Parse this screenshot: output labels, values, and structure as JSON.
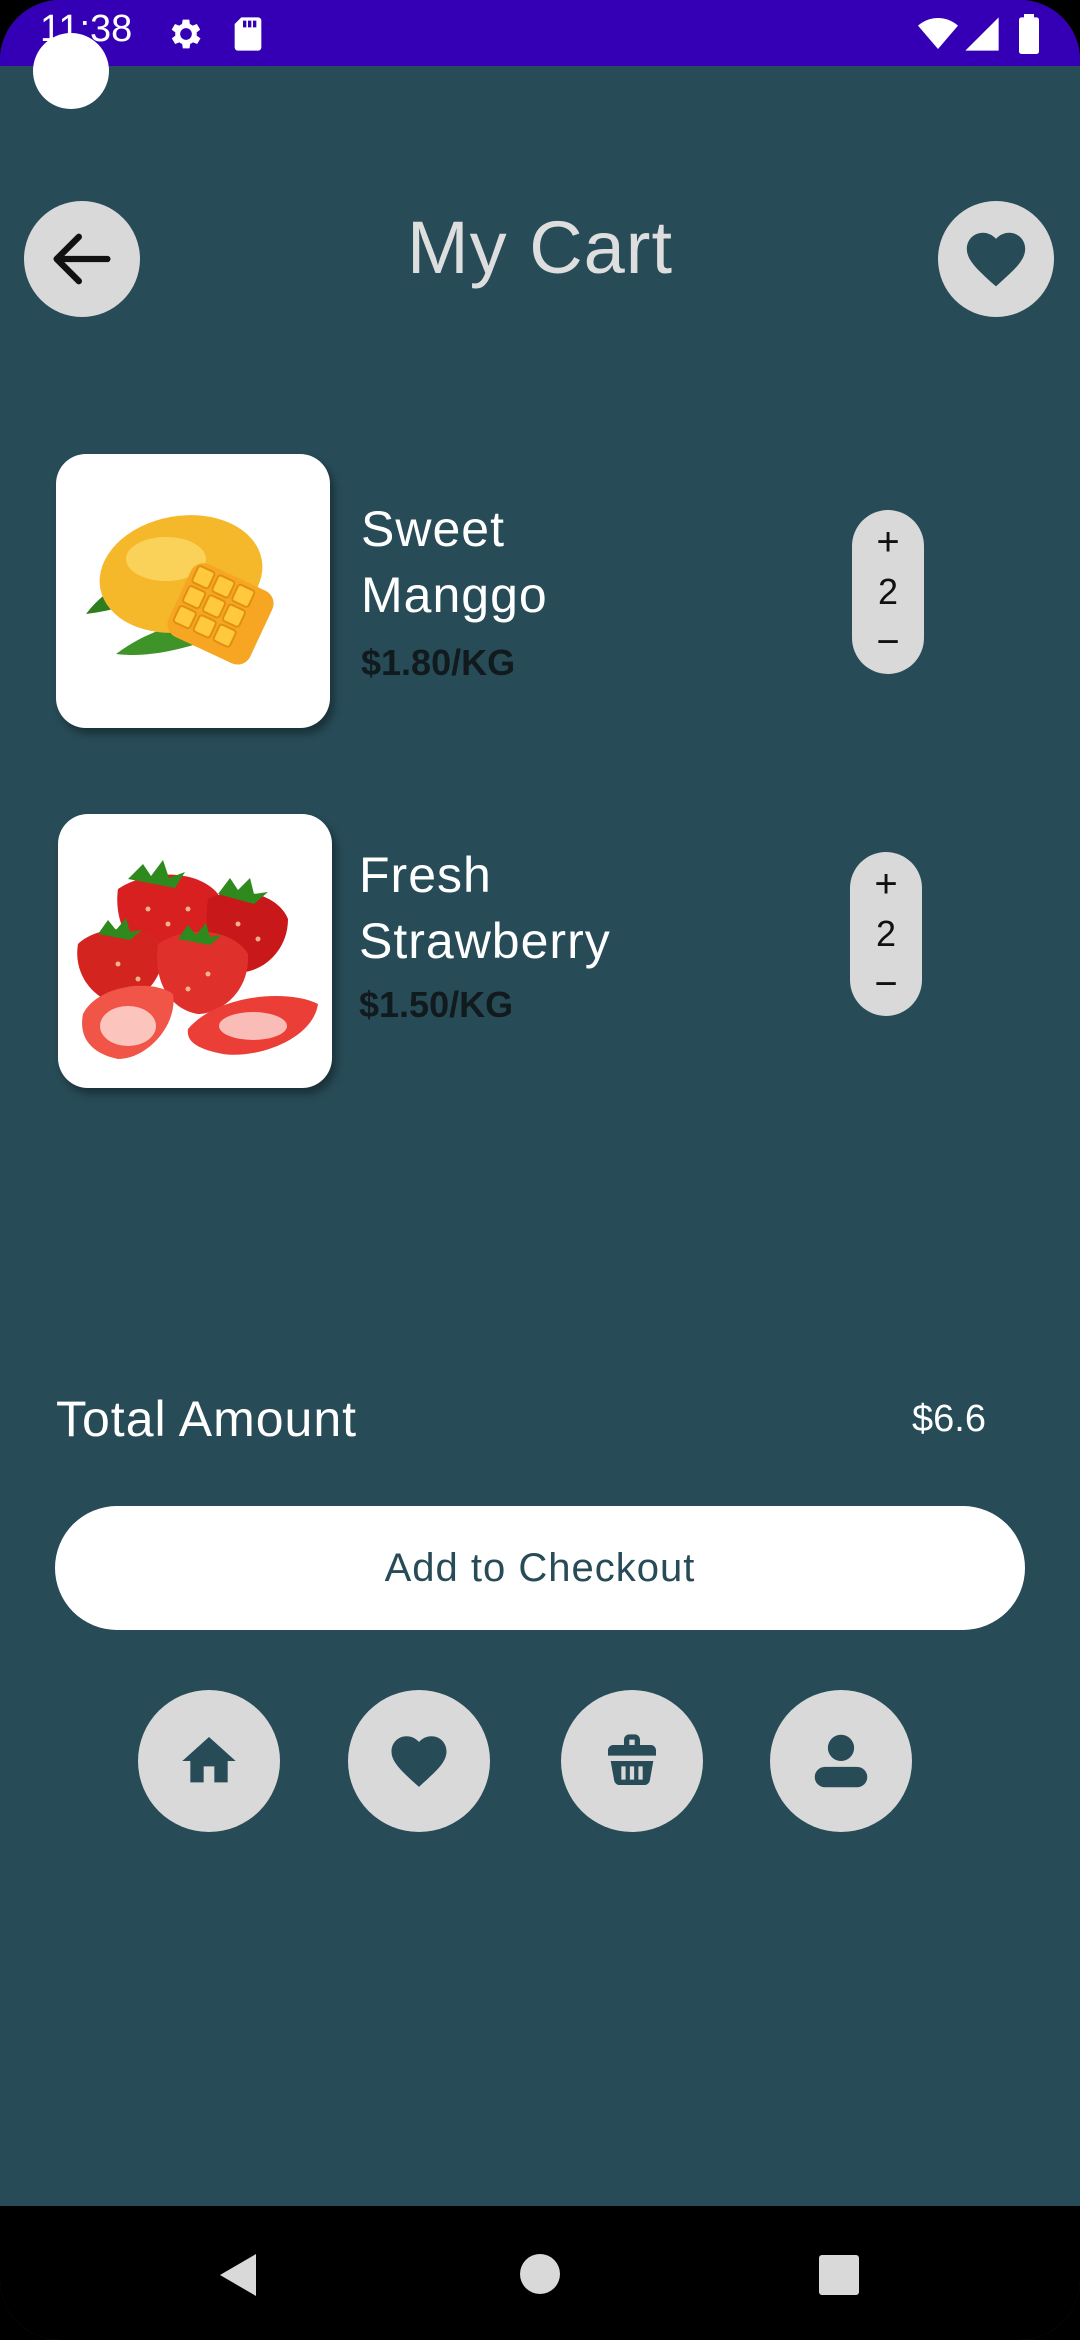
{
  "status_bar": {
    "time": "11:38",
    "icons": [
      "gear-icon",
      "sd-card-icon",
      "wifi-icon",
      "signal-icon",
      "battery-icon"
    ],
    "background": "#3500b5"
  },
  "header": {
    "title": "My Cart",
    "back_icon": "arrow-left-icon",
    "favorite_icon": "heart-icon"
  },
  "cart": {
    "items": [
      {
        "name_line1": "Sweet",
        "name_line2": "Manggo",
        "price": "$1.80/KG",
        "quantity": "2",
        "image": "mango-image"
      },
      {
        "name_line1": "Fresh",
        "name_line2": "Strawberry",
        "price": "$1.50/KG",
        "quantity": "2",
        "image": "strawberry-image"
      }
    ],
    "stepper_plus": "+",
    "stepper_minus": "−"
  },
  "summary": {
    "total_label": "Total Amount",
    "total_value": "$6.6",
    "checkout_label": "Add to Checkout"
  },
  "bottom_nav": {
    "icons": [
      "home-icon",
      "heart-icon",
      "basket-icon",
      "user-icon"
    ]
  },
  "colors": {
    "background": "#274b57",
    "button_grey": "#d9d9d9",
    "white": "#ffffff"
  }
}
